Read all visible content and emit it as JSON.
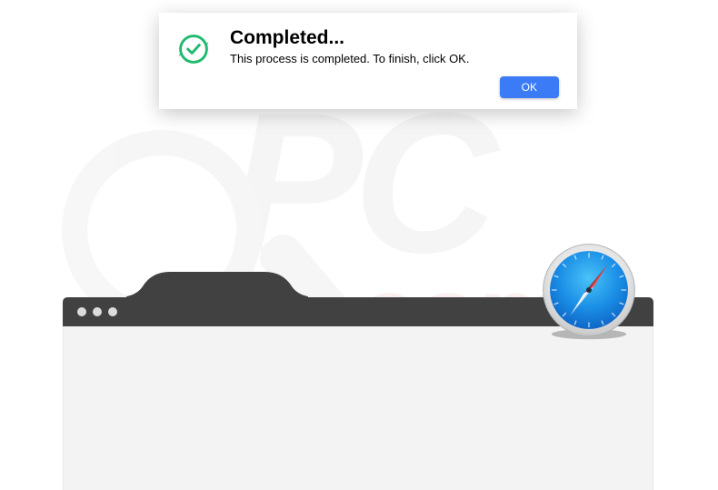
{
  "dialog": {
    "title": "Completed...",
    "message": "This process is completed. To finish, click OK.",
    "ok_label": "OK",
    "icon_name": "checkmark-circle-icon"
  },
  "watermark": {
    "top_text": "PC",
    "bottom_text": "risk.com"
  },
  "colors": {
    "button_bg": "#3b7bf6",
    "check_color": "#21b96f",
    "titlebar_bg": "#414141",
    "content_bg": "#f3f3f3"
  },
  "browser": {
    "app_name": "Safari"
  }
}
